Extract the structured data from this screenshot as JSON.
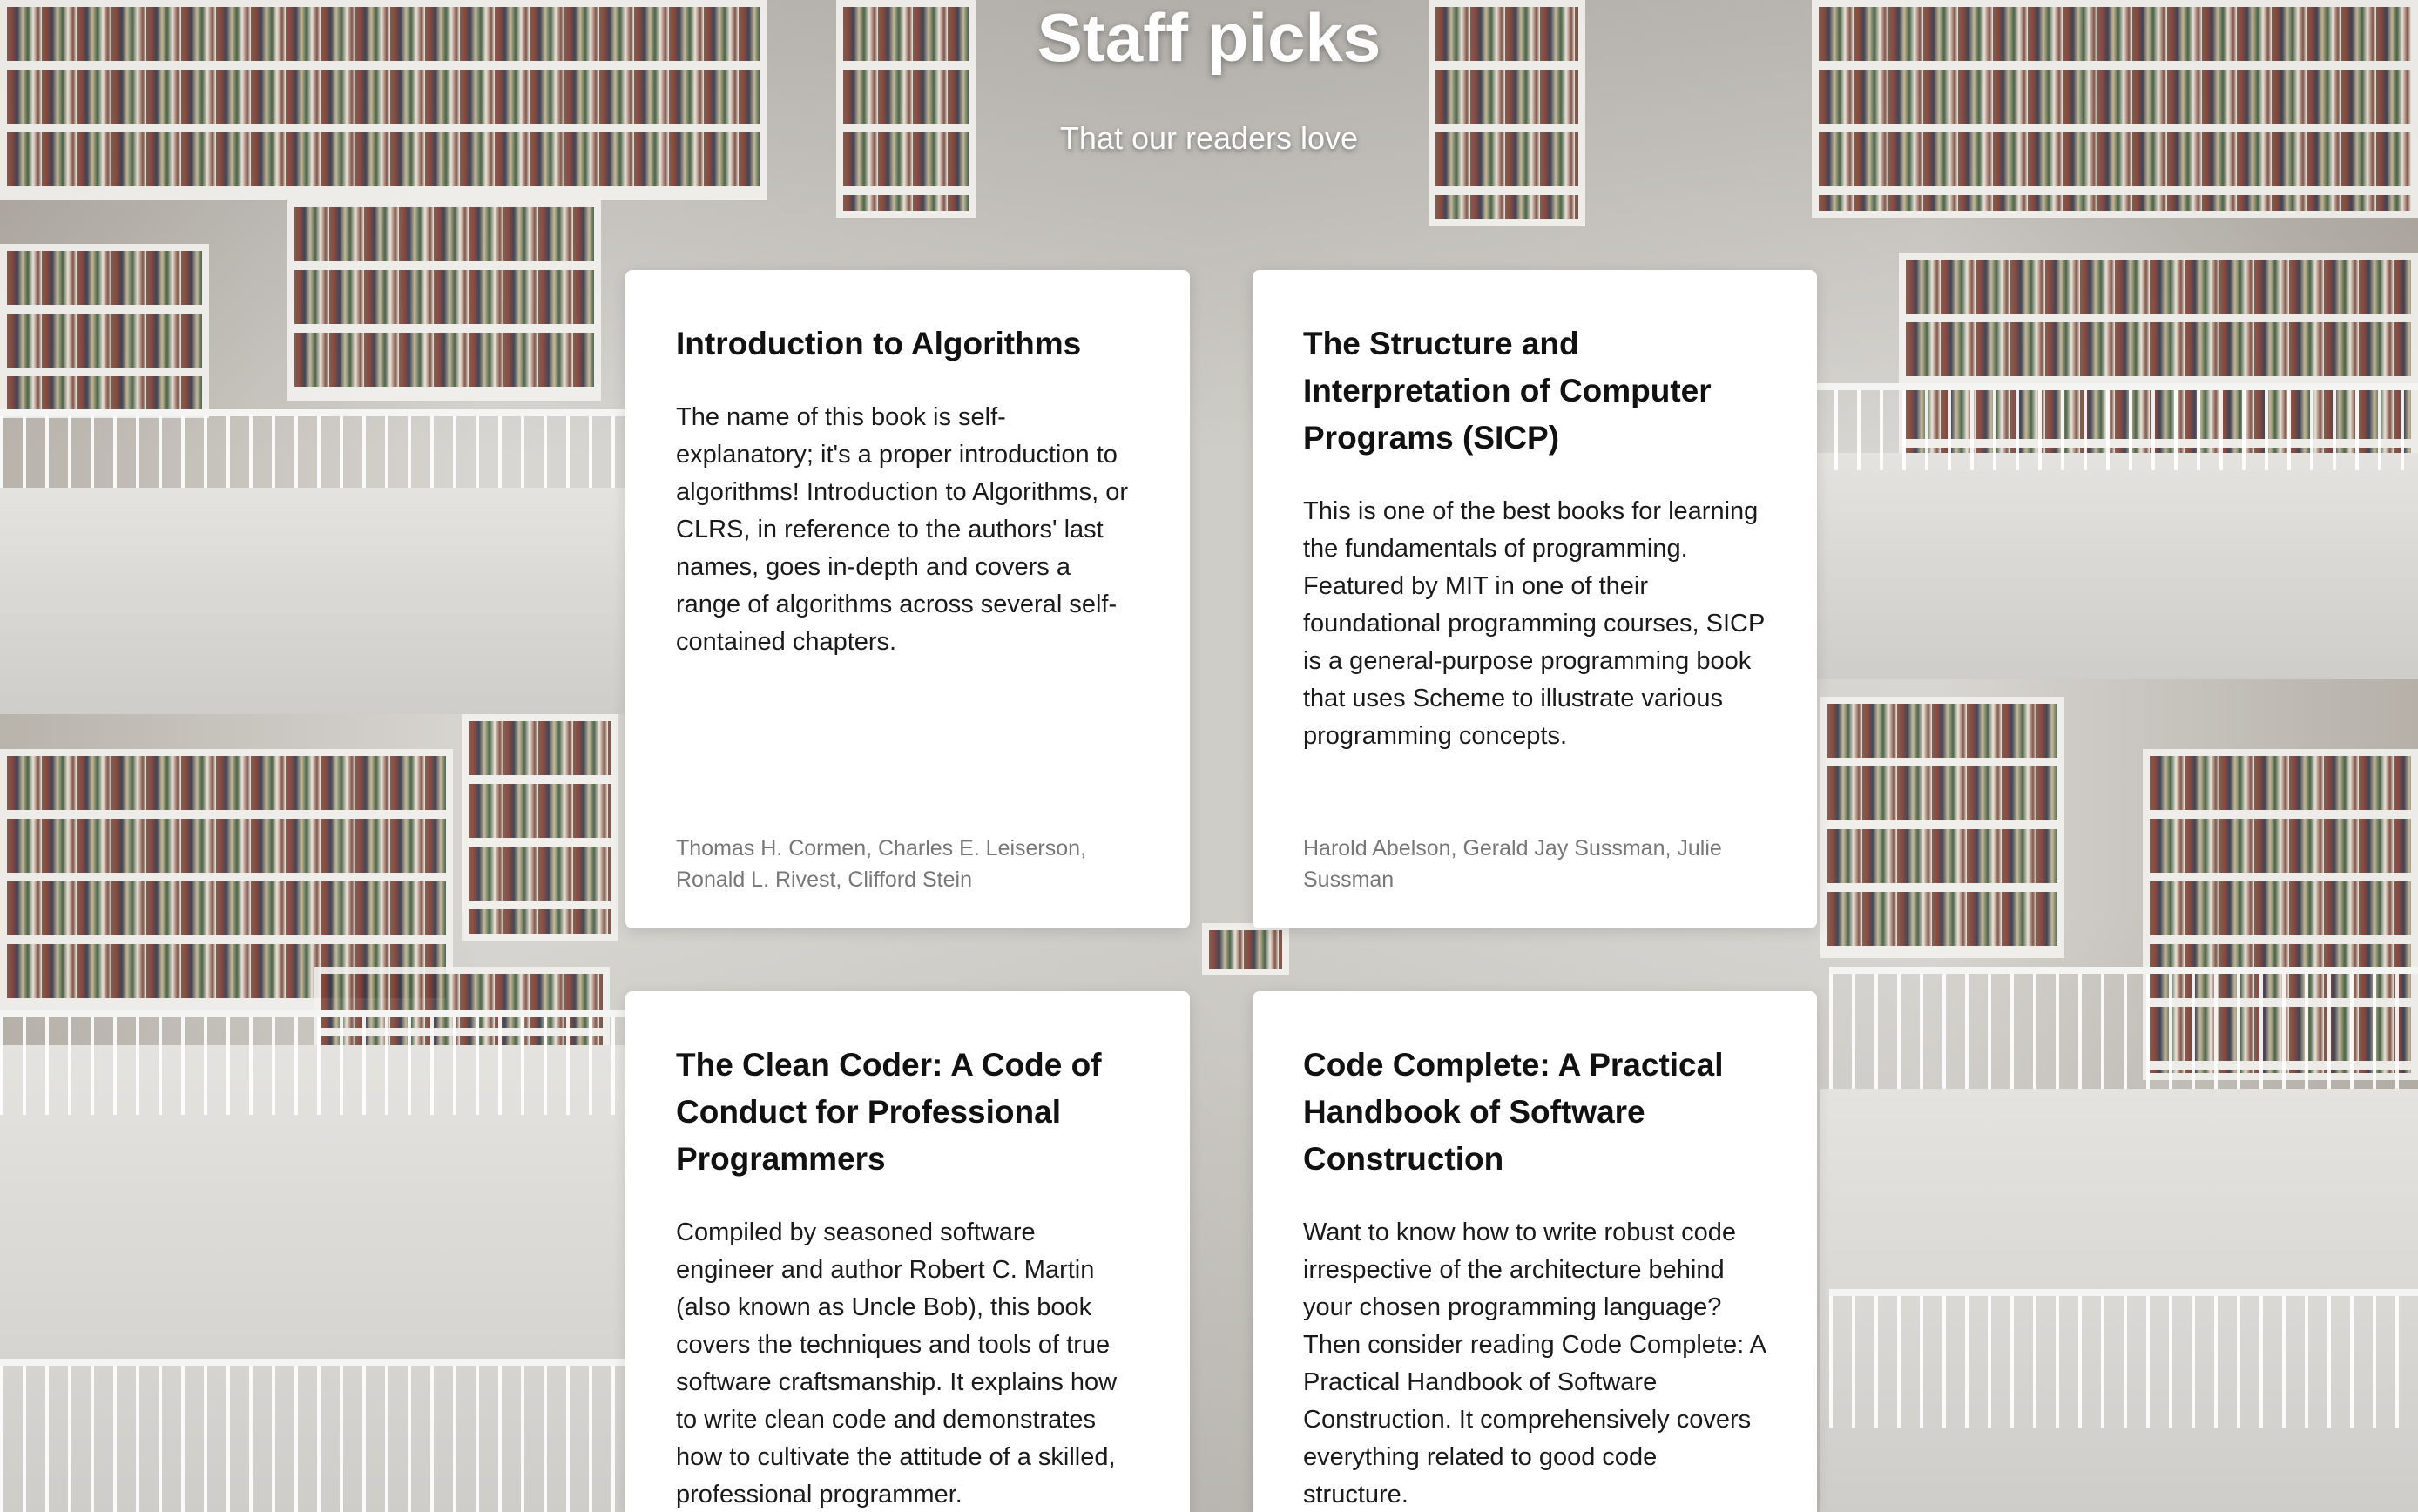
{
  "page": {
    "title": "Staff picks",
    "subtitle": "That our readers love"
  },
  "books": [
    {
      "title": "Introduction to Algorithms",
      "description": "The name of this book is self-explanatory; it's a proper introduction to algorithms! Introduction to Algorithms, or CLRS, in reference to the authors' last names, goes in-depth and covers a range of algorithms across several self-contained chapters.",
      "authors": "Thomas H. Cormen, Charles E. Leiserson, Ronald L. Rivest, Clifford Stein"
    },
    {
      "title": "The Structure and Interpretation of Computer Programs (SICP)",
      "description": "This is one of the best books for learning the fundamentals of programming. Featured by MIT in one of their foundational programming courses, SICP is a general-purpose programming book that uses Scheme to illustrate various programming concepts.",
      "authors": "Harold Abelson, Gerald Jay Sussman, Julie Sussman"
    },
    {
      "title": "The Clean Coder: A Code of Conduct for Professional Programmers",
      "description": "Compiled by seasoned software engineer and author Robert C. Martin (also known as Uncle Bob), this book covers the techniques and tools of true software craftsmanship. It explains how to write clean code and demonstrates how to cultivate the attitude of a skilled, professional programmer.",
      "authors": ""
    },
    {
      "title": "Code Complete: A Practical Handbook of Software Construction",
      "description": "Want to know how to write robust code irrespective of the architecture behind your chosen programming language? Then consider reading Code Complete: A Practical Handbook of Software Construction. It comprehensively covers everything related to good code structure.",
      "authors": ""
    }
  ]
}
